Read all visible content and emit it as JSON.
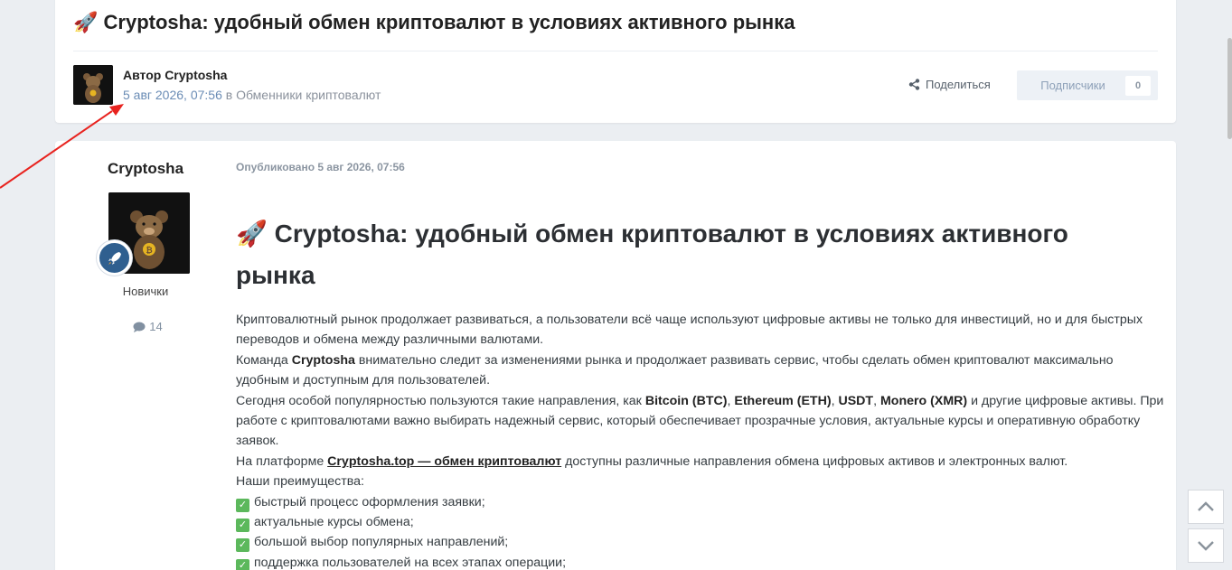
{
  "header": {
    "title_emoji": "🚀",
    "title": "Cryptosha: удобный обмен криптовалют в условиях активного рынка",
    "author_line": "Автор Cryptosha",
    "date": "5 авг 2026, 07:56",
    "in_word": "в",
    "category": "Обменники криптовалют",
    "share_label": "Поделиться",
    "follow_label": "Подписчики",
    "follow_count": "0"
  },
  "post": {
    "author_name": "Cryptosha",
    "member_group": "Новички",
    "post_count": "14",
    "published": "Опубликовано 5 авг 2026, 07:56",
    "heading_emoji": "🚀",
    "heading": "Cryptosha: удобный обмен криптовалют в условиях активного рынка",
    "p1": "Криптовалютный рынок продолжает развиваться, а пользователи всё чаще используют цифровые активы не только для инвестиций, но и для быстрых переводов и обмена между различными валютами.",
    "p2_a": "Команда ",
    "p2_b": "Cryptosha",
    "p2_c": " внимательно следит за изменениями рынка и продолжает развивать сервис, чтобы сделать обмен криптовалют максимально удобным и доступным для пользователей.",
    "p3_a": "Сегодня особой популярностью пользуются такие направления, как ",
    "p3_btc": "Bitcoin (BTC)",
    "p3_sep1": ", ",
    "p3_eth": "Ethereum (ETH)",
    "p3_sep2": ", ",
    "p3_usdt": "USDT",
    "p3_sep3": ", ",
    "p3_xmr": "Monero (XMR)",
    "p3_b": " и другие цифровые активы. При работе с криптовалютами важно выбирать надежный сервис, который обеспечивает прозрачные условия, актуальные курсы и оперативную обработку заявок.",
    "p4_a": "На платформе ",
    "p4_link": "Cryptosha.top — обмен криптовалют",
    "p4_b": " доступны различные направления обмена цифровых активов и электронных валют.",
    "advantages_title": "Наши преимущества:",
    "advantages": [
      "быстрый процесс оформления заявки;",
      "актуальные курсы обмена;",
      "большой выбор популярных направлений;",
      "поддержка пользователей на всех этапах операции;"
    ]
  },
  "icons": {
    "share": "share-icon",
    "comment": "comment-icon",
    "rank": "rocket-icon",
    "check": "check-icon",
    "scroll_up": "chevron-up-icon",
    "scroll_down": "chevron-down-icon"
  },
  "colors": {
    "accent_link": "#6a8cb5",
    "annotation_arrow": "#e8231f",
    "check_green": "#5cb85c"
  }
}
